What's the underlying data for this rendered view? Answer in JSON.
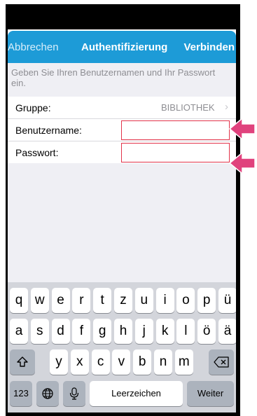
{
  "navbar": {
    "cancel_label": "Abbrechen",
    "title": "Authentifizierung",
    "connect_label": "Verbinden"
  },
  "form": {
    "instructions": "Geben Sie Ihren Benutzernamen und Ihr Passwort ein.",
    "group_label": "Gruppe:",
    "group_value": "BIBLIOTHEK",
    "username_label": "Benutzername:",
    "username_value": "",
    "password_label": "Passwort:",
    "password_value": ""
  },
  "keyboard": {
    "row1": [
      "q",
      "w",
      "e",
      "r",
      "t",
      "z",
      "u",
      "i",
      "o",
      "p",
      "ü"
    ],
    "row2": [
      "a",
      "s",
      "d",
      "f",
      "g",
      "h",
      "j",
      "k",
      "l",
      "ö",
      "ä"
    ],
    "row3": [
      "y",
      "x",
      "c",
      "v",
      "b",
      "n",
      "m"
    ],
    "numbers_label": "123",
    "space_label": "Leerzeichen",
    "return_label": "Weiter"
  },
  "colors": {
    "accent": "#1d9bd7",
    "field_border": "#e2334a",
    "annotation_arrow": "#e0427d"
  }
}
